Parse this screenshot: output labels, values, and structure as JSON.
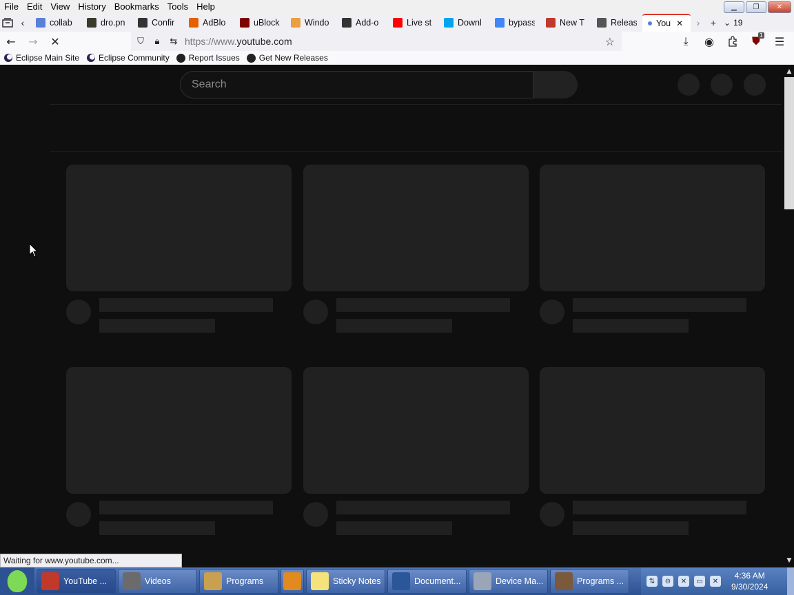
{
  "menubar": {
    "items": [
      "File",
      "Edit",
      "View",
      "History",
      "Bookmarks",
      "Tools",
      "Help"
    ]
  },
  "tabs": {
    "items": [
      {
        "label": "collab",
        "icon": "dot-icon",
        "color": "#5a7fd6"
      },
      {
        "label": "dro.pn",
        "icon": "image-icon",
        "color": "#3a3a2a"
      },
      {
        "label": "Confir",
        "icon": "b-icon",
        "color": "#333333"
      },
      {
        "label": "AdBlo",
        "icon": "firefox-icon",
        "color": "#e66000"
      },
      {
        "label": "uBlock",
        "icon": "ublock-icon",
        "color": "#800000"
      },
      {
        "label": "Windo",
        "icon": "diamond-icon",
        "color": "#e8a040"
      },
      {
        "label": "Add-o",
        "icon": "puzzle-icon",
        "color": "#333333"
      },
      {
        "label": "Live st",
        "icon": "youtube-icon",
        "color": "#ff0000"
      },
      {
        "label": "Downl",
        "icon": "windows-icon",
        "color": "#00a4ef"
      },
      {
        "label": "bypass",
        "icon": "google-icon",
        "color": "#4285f4"
      },
      {
        "label": "New T",
        "icon": "tab-icon",
        "color": "#c0392b"
      },
      {
        "label": "Releas",
        "icon": "github-icon",
        "color": "#555555"
      }
    ],
    "active": {
      "label": "You",
      "close": "✕"
    },
    "count": "19"
  },
  "navbar": {
    "url_prefix": "https://www.",
    "url_domain": "youtube.com"
  },
  "bookmarks": {
    "items": [
      {
        "label": "Eclipse Main Site",
        "icon": "eclipse-icon"
      },
      {
        "label": "Eclipse Community",
        "icon": "eclipse-icon"
      },
      {
        "label": "Report Issues",
        "icon": "github-icon"
      },
      {
        "label": "Get New Releases",
        "icon": "github-icon"
      }
    ]
  },
  "page": {
    "search_placeholder": "Search",
    "status": "Waiting for www.youtube.com..."
  },
  "toolbar": {
    "ublock_badge": "1"
  },
  "taskbar": {
    "tasks": [
      {
        "label": "YouTube ...",
        "icon": "firefox-icon",
        "color": "#c0392b"
      },
      {
        "label": "Videos",
        "icon": "film-icon",
        "color": "#6b6b6b"
      },
      {
        "label": "Programs",
        "icon": "folder-icon",
        "color": "#c8a050"
      },
      {
        "label": "",
        "icon": "media-player-icon",
        "color": "#e08a20"
      },
      {
        "label": "Sticky Notes",
        "icon": "sticky-notes-icon",
        "color": "#f5e27a"
      },
      {
        "label": "Document...",
        "icon": "word-icon",
        "color": "#2b579a"
      },
      {
        "label": "Device Ma...",
        "icon": "device-manager-icon",
        "color": "#9aa6b8"
      },
      {
        "label": "Programs ...",
        "icon": "programs-icon",
        "color": "#7a5a3a"
      }
    ],
    "clock_time": "4:36 AM",
    "clock_date": "9/30/2024"
  }
}
